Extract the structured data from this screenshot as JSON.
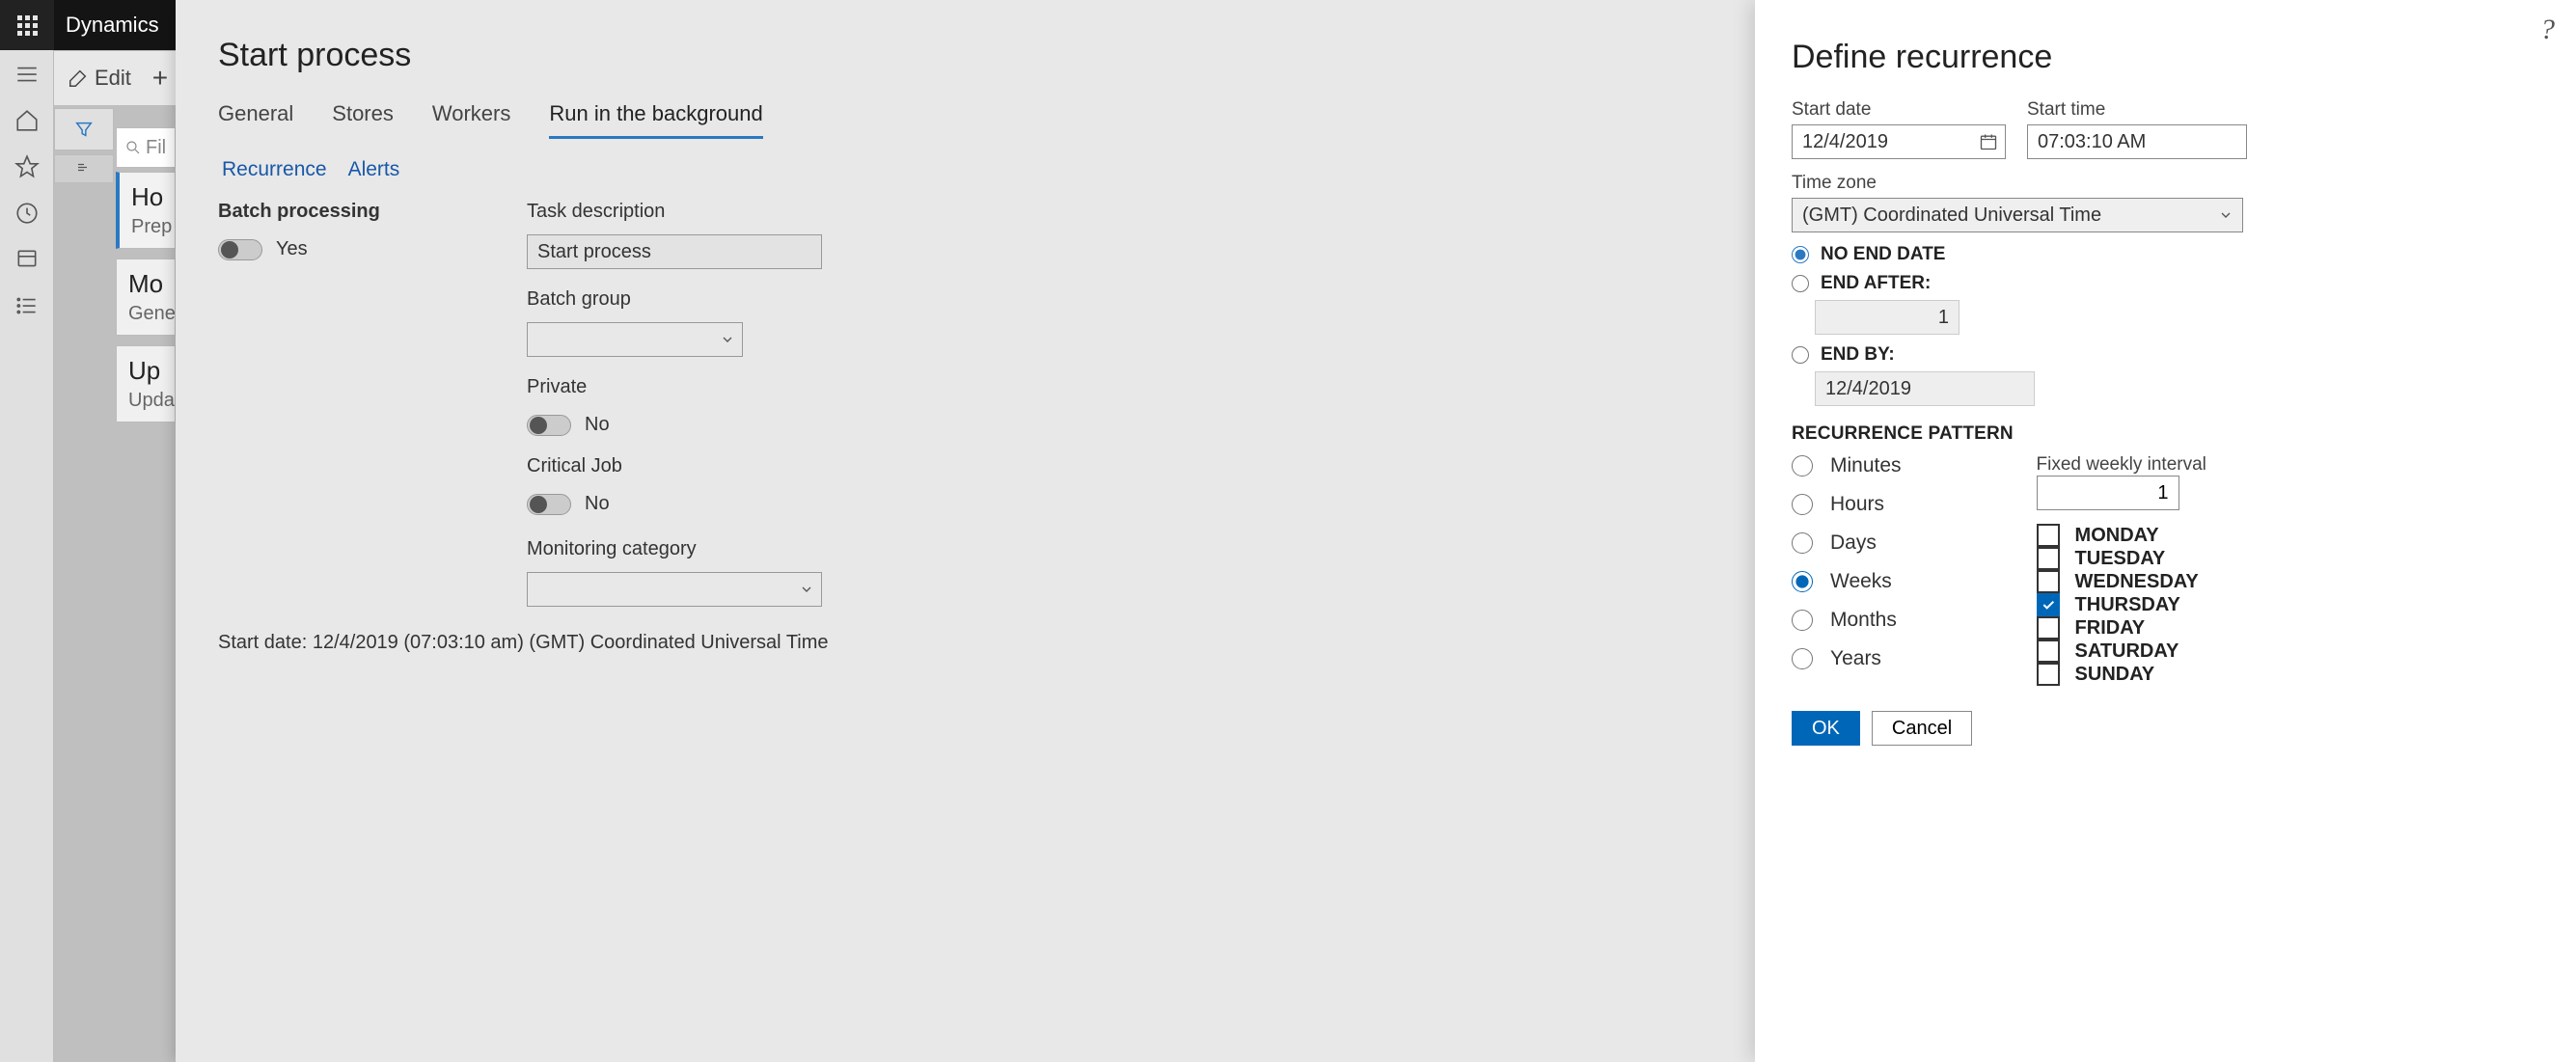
{
  "topbar": {
    "brand": "Dynamics"
  },
  "toolbar": {
    "edit": "Edit"
  },
  "leftrail": {},
  "filter": {
    "placeholder": "Fil"
  },
  "cards": [
    {
      "title": "Ho",
      "sub": "Prep"
    },
    {
      "title": "Mo",
      "sub": "Gene"
    },
    {
      "title": "Up",
      "sub": "Upda"
    }
  ],
  "modal": {
    "title": "Start process",
    "tabs": [
      "General",
      "Stores",
      "Workers",
      "Run in the background"
    ],
    "active_tab_index": 3,
    "subtabs": [
      "Recurrence",
      "Alerts"
    ],
    "batch_processing": {
      "label": "Batch processing",
      "state_text": "Yes"
    },
    "task_desc": {
      "label": "Task description",
      "value": "Start process"
    },
    "batch_group": {
      "label": "Batch group",
      "value": ""
    },
    "private": {
      "label": "Private",
      "state_text": "No"
    },
    "critical": {
      "label": "Critical Job",
      "state_text": "No"
    },
    "mon_cat": {
      "label": "Monitoring category",
      "value": ""
    },
    "footer": "Start date: 12/4/2019 (07:03:10 am) (GMT) Coordinated Universal Time"
  },
  "panel": {
    "title": "Define recurrence",
    "start_date": {
      "label": "Start date",
      "value": "12/4/2019"
    },
    "start_time": {
      "label": "Start time",
      "value": "07:03:10 AM"
    },
    "tz": {
      "label": "Time zone",
      "value": "(GMT) Coordinated Universal Time"
    },
    "end_opts": {
      "no_end": "NO END DATE",
      "end_after": "END AFTER:",
      "end_after_value": "1",
      "end_by": "END BY:",
      "end_by_value": "12/4/2019",
      "selected": "no_end"
    },
    "pattern_title": "RECURRENCE PATTERN",
    "pattern": {
      "options": [
        "Minutes",
        "Hours",
        "Days",
        "Weeks",
        "Months",
        "Years"
      ],
      "selected_index": 3
    },
    "fixed_interval": {
      "label": "Fixed weekly interval",
      "value": "1"
    },
    "days": [
      {
        "label": "MONDAY",
        "checked": false
      },
      {
        "label": "TUESDAY",
        "checked": false
      },
      {
        "label": "WEDNESDAY",
        "checked": false
      },
      {
        "label": "THURSDAY",
        "checked": true
      },
      {
        "label": "FRIDAY",
        "checked": false
      },
      {
        "label": "SATURDAY",
        "checked": false
      },
      {
        "label": "SUNDAY",
        "checked": false
      }
    ],
    "buttons": {
      "ok": "OK",
      "cancel": "Cancel"
    }
  }
}
